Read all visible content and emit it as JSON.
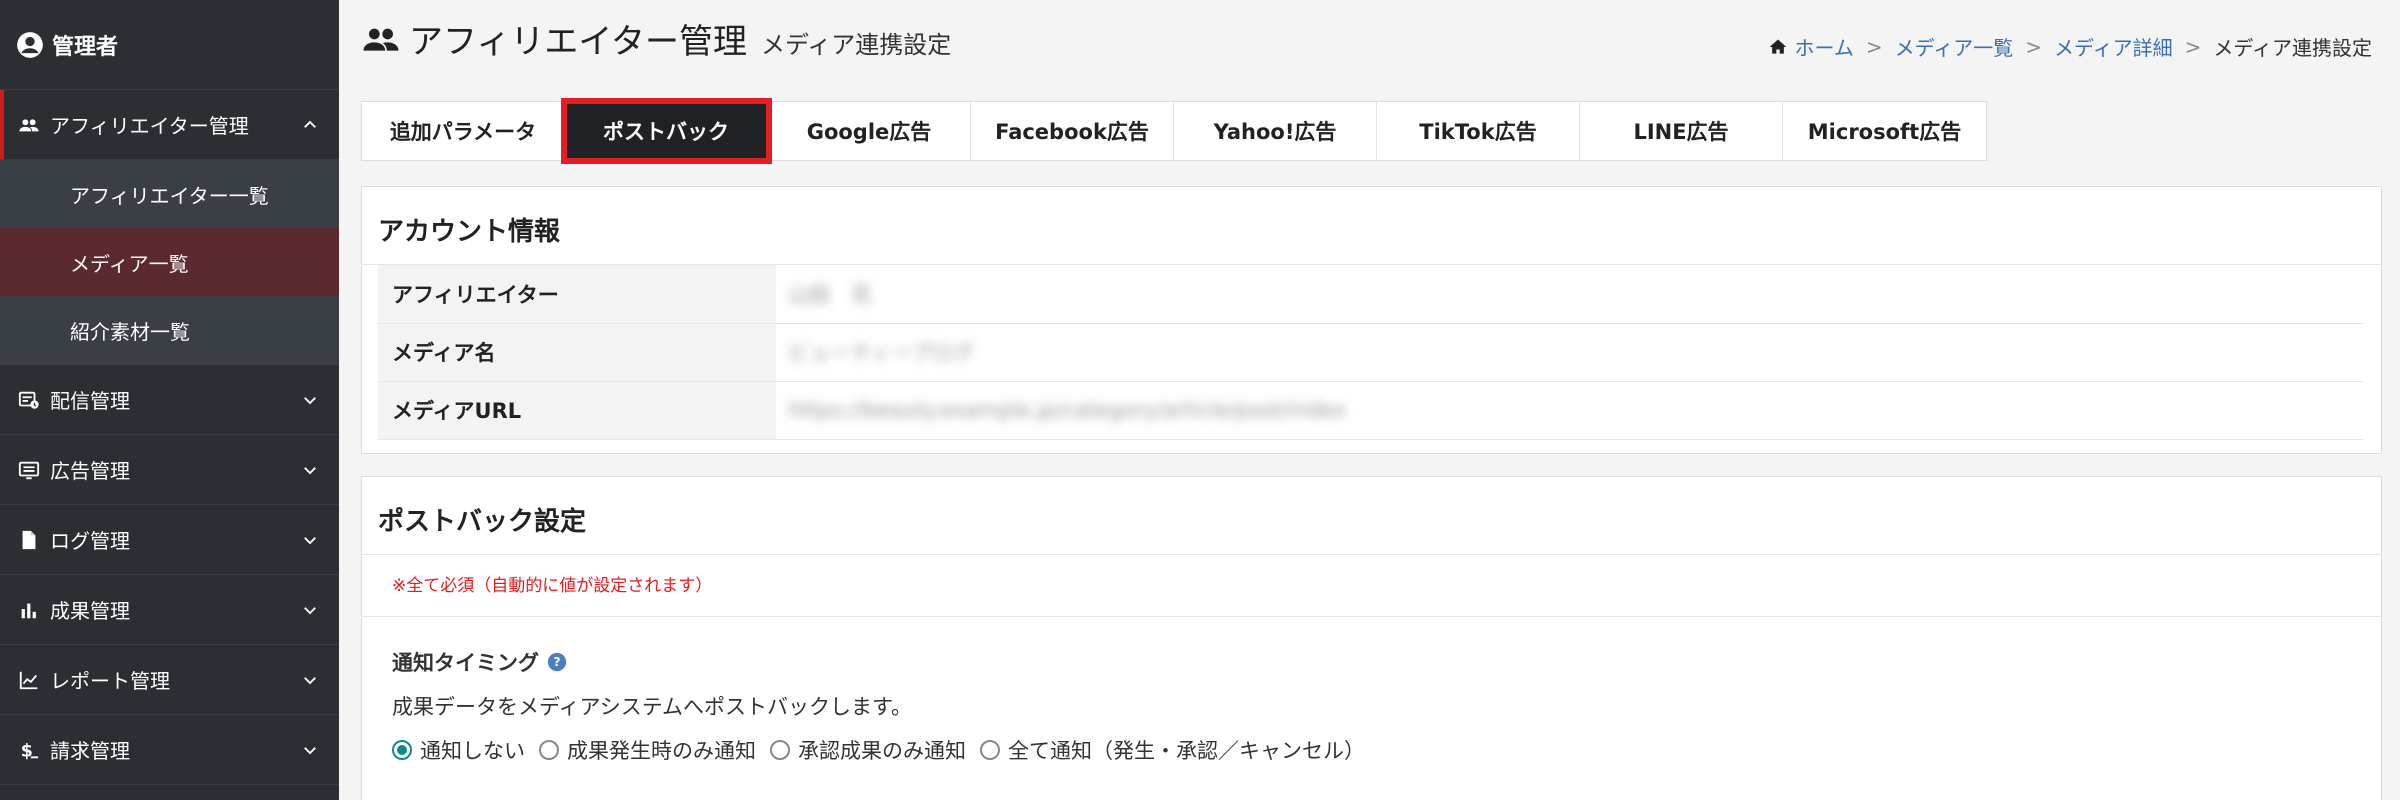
{
  "sidebar": {
    "user": "管理者",
    "items": [
      {
        "label": "アフィリエイター管理",
        "icon": "people-icon",
        "open": true
      },
      {
        "label": "配信管理",
        "icon": "schedule-icon"
      },
      {
        "label": "広告管理",
        "icon": "ad-icon"
      },
      {
        "label": "ログ管理",
        "icon": "document-icon"
      },
      {
        "label": "成果管理",
        "icon": "bar-chart-icon"
      },
      {
        "label": "レポート管理",
        "icon": "line-chart-icon"
      },
      {
        "label": "請求管理",
        "icon": "dollar-icon"
      }
    ],
    "sub_items": [
      {
        "label": "アフィリエイター一覧"
      },
      {
        "label": "メディア一覧",
        "active": true
      },
      {
        "label": "紹介素材一覧"
      }
    ]
  },
  "header": {
    "title": "アフィリエイター管理",
    "subtitle": "メディア連携設定"
  },
  "breadcrumb": {
    "items": [
      "ホーム",
      "メディア一覧",
      "メディア詳細"
    ],
    "current": "メディア連携設定",
    "separator": ">"
  },
  "tabs": [
    {
      "label": "追加パラメータ"
    },
    {
      "label": "ポストバック",
      "active": true
    },
    {
      "label": "Google広告"
    },
    {
      "label": "Facebook広告"
    },
    {
      "label": "Yahoo!広告"
    },
    {
      "label": "TikTok広告"
    },
    {
      "label": "LINE広告"
    },
    {
      "label": "Microsoft広告"
    }
  ],
  "account": {
    "heading": "アカウント情報",
    "rows": [
      {
        "key": "アフィリエイター",
        "value": "山田　花"
      },
      {
        "key": "メディア名",
        "value": "ビューティーブログ"
      },
      {
        "key": "メディアURL",
        "value": "https://beauty.example.jp/category/article/post/index"
      }
    ]
  },
  "postback": {
    "heading": "ポストバック設定",
    "note": "※全て必須（自動的に値が設定されます）",
    "field_label": "通知タイミング",
    "description": "成果データをメディアシステムへポストバックします。",
    "options": [
      {
        "label": "通知しない",
        "checked": true
      },
      {
        "label": "成果発生時のみ通知"
      },
      {
        "label": "承認成果のみ通知"
      },
      {
        "label": "全て通知（発生・承認／キャンセル）"
      }
    ]
  },
  "colors": {
    "sidebar_bg": "#2b2e33",
    "active_tab_bg": "#1f2125",
    "highlight": "#e21f26",
    "link": "#3a6fb0",
    "radio_checked": "#0f8a8a"
  }
}
